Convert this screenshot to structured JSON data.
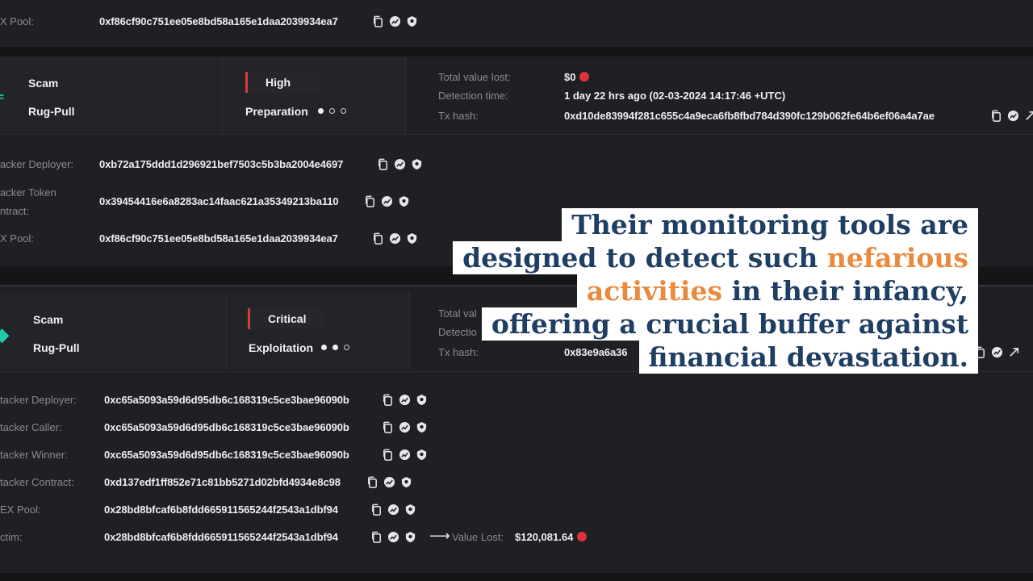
{
  "top": {
    "dex_pool_label": "X Pool:",
    "dex_pool_value": "0xf86cf90c751ee05e8bd58a165e1daa2039934ea7"
  },
  "alert1": {
    "type1": "Scam",
    "type2": "Rug-Pull",
    "severity": "High",
    "stage": "Preparation",
    "stage_dots": [
      1,
      0,
      0
    ],
    "total_value_lost_label": "Total value lost:",
    "total_value_lost": "$0",
    "detection_time_label": "Detection time:",
    "detection_time": "1 day 22 hrs ago (02-03-2024 14:17:46 +UTC)",
    "tx_hash_label": "Tx hash:",
    "tx_hash": "0xd10de83994f281c655c4a9eca6fb8fbd784d390fc129b062fe64b6ef06a4a7ae",
    "rows": [
      {
        "label": "acker Deployer:",
        "value": "0xb72a175ddd1d296921bef7503c5b3ba2004e4697"
      },
      {
        "label": "acker Token",
        "label2": "ntract:",
        "value": "0x39454416e6a8283ac14faac621a35349213ba110"
      },
      {
        "label": "X Pool:",
        "value": "0xf86cf90c751ee05e8bd58a165e1daa2039934ea7"
      }
    ]
  },
  "alert2": {
    "type1": "Scam",
    "type2": "Rug-Pull",
    "severity": "Critical",
    "stage": "Exploitation",
    "stage_dots": [
      1,
      1,
      0
    ],
    "total_value_label": "Total val",
    "detection_label": "Detectio",
    "tx_hash_label": "Tx hash:",
    "tx_hash_partial": "0x83e9a6a36",
    "rows": [
      {
        "label": "tacker Deployer:",
        "value": "0xc65a5093a59d6d95db6c168319c5ce3bae96090b"
      },
      {
        "label": "tacker Caller:",
        "value": "0xc65a5093a59d6d95db6c168319c5ce3bae96090b"
      },
      {
        "label": "tacker Winner:",
        "value": "0xc65a5093a59d6d95db6c168319c5ce3bae96090b"
      },
      {
        "label": "tacker Contract:",
        "value": "0xd137edf1ff852e71c81bb5271d02bfd4934e8c98"
      },
      {
        "label": "EX Pool:",
        "value": "0x28bd8bfcaf6b8fdd665911565244f2543a1dbf94"
      },
      {
        "label": "ctim:",
        "value": "0x28bd8bfcaf6b8fdd665911565244f2543a1dbf94"
      }
    ],
    "value_lost_label": "Value Lost:",
    "value_lost": "$120,081.64"
  },
  "caption": {
    "line1": "Their monitoring tools are",
    "line2_a": "designed to detect such ",
    "line2_b": "nefarious",
    "line3_a": "activities",
    "line3_b": " in their infancy,",
    "line4": "offering a crucial buffer against",
    "line5": "financial devastation."
  },
  "colors": {
    "background": "#141517",
    "card": "#1f2023",
    "severity_bar": "#d83a3a",
    "danger_dot": "#e0323c",
    "caption_text": "#1f3e63",
    "caption_highlight": "#e98a3f"
  },
  "icons": [
    "copy-icon",
    "chart-icon",
    "shield-icon"
  ]
}
